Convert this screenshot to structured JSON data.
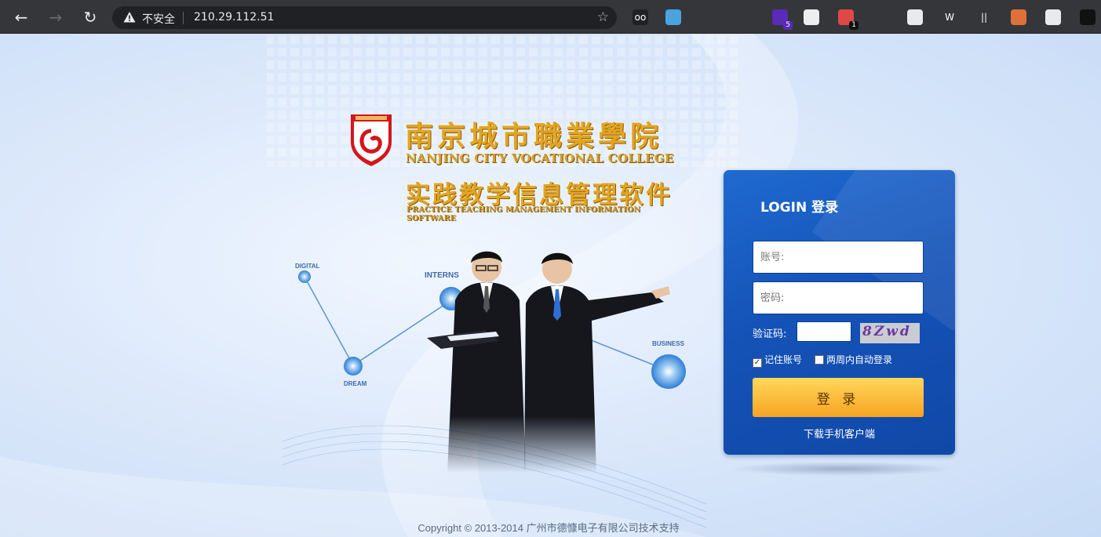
{
  "browser": {
    "security_label": "不安全",
    "url": "210.29.112.51",
    "extensions": [
      {
        "name": "sunglasses-extension-icon",
        "glyph": "oo",
        "bg": "#202124"
      },
      {
        "name": "circle-extension-icon",
        "glyph": "",
        "bg": "#4aa3df"
      },
      {
        "name": "eye-extension-icon",
        "glyph": "",
        "bg": "#35363a"
      },
      {
        "name": "pin-extension-icon",
        "glyph": "",
        "bg": "#35363a"
      },
      {
        "name": "purple-extension-icon",
        "glyph": "",
        "bg": "#5a2ab8",
        "badge": "5"
      },
      {
        "name": "qr-extension-icon",
        "glyph": "",
        "bg": "#eeeeee"
      },
      {
        "name": "tag-extension-icon",
        "glyph": "",
        "bg": "#e04848",
        "badge": "1"
      },
      {
        "name": "hat-extension-icon",
        "glyph": "",
        "bg": "#35363a"
      },
      {
        "name": "face-extension-icon",
        "glyph": "",
        "bg": "#e8eaed"
      },
      {
        "name": "w-extension-icon",
        "glyph": "W",
        "bg": "#35363a"
      },
      {
        "name": "bars-extension-icon",
        "glyph": "||",
        "bg": "#35363a"
      },
      {
        "name": "mascot-extension-icon",
        "glyph": "",
        "bg": "#e0703a"
      },
      {
        "name": "window-extension-icon",
        "glyph": "",
        "bg": "#e8eaed"
      },
      {
        "name": "square-extension-icon",
        "glyph": "",
        "bg": "#111111"
      }
    ]
  },
  "brand": {
    "name_cn": "南京城市職業學院",
    "name_en": "NANJING CITY VOCATIONAL COLLEGE",
    "system_cn": "实践教学信息管理软件",
    "system_en": "PRACTICE TEACHING MANAGEMENT INFORMATION SOFTWARE",
    "emblem_colors": {
      "red": "#d3161c",
      "white": "#ffffff",
      "gold": "#e3a520"
    }
  },
  "illustration": {
    "nodes": [
      {
        "label": "DIGITAL"
      },
      {
        "label": "INTERNS"
      },
      {
        "label": "DREAM"
      },
      {
        "label": "BUSINESS"
      }
    ]
  },
  "login": {
    "title": "LOGIN 登录",
    "account_placeholder": "账号:",
    "password_placeholder": "密码:",
    "captcha_label": "验证码:",
    "captcha_text": "8Zwd",
    "remember_label": "记住账号",
    "remember_checked": true,
    "auto_login_label": "两周内自动登录",
    "auto_login_checked": false,
    "login_button": "登 录",
    "download_link": "下载手机客户端"
  },
  "footer": {
    "copyright": "Copyright © 2013-2014 广州市德慷电子有限公司技术支持"
  },
  "colors": {
    "panel_blue": "#1553b8",
    "button_orange": "#f7a322",
    "page_bg": "#dde9fb"
  }
}
